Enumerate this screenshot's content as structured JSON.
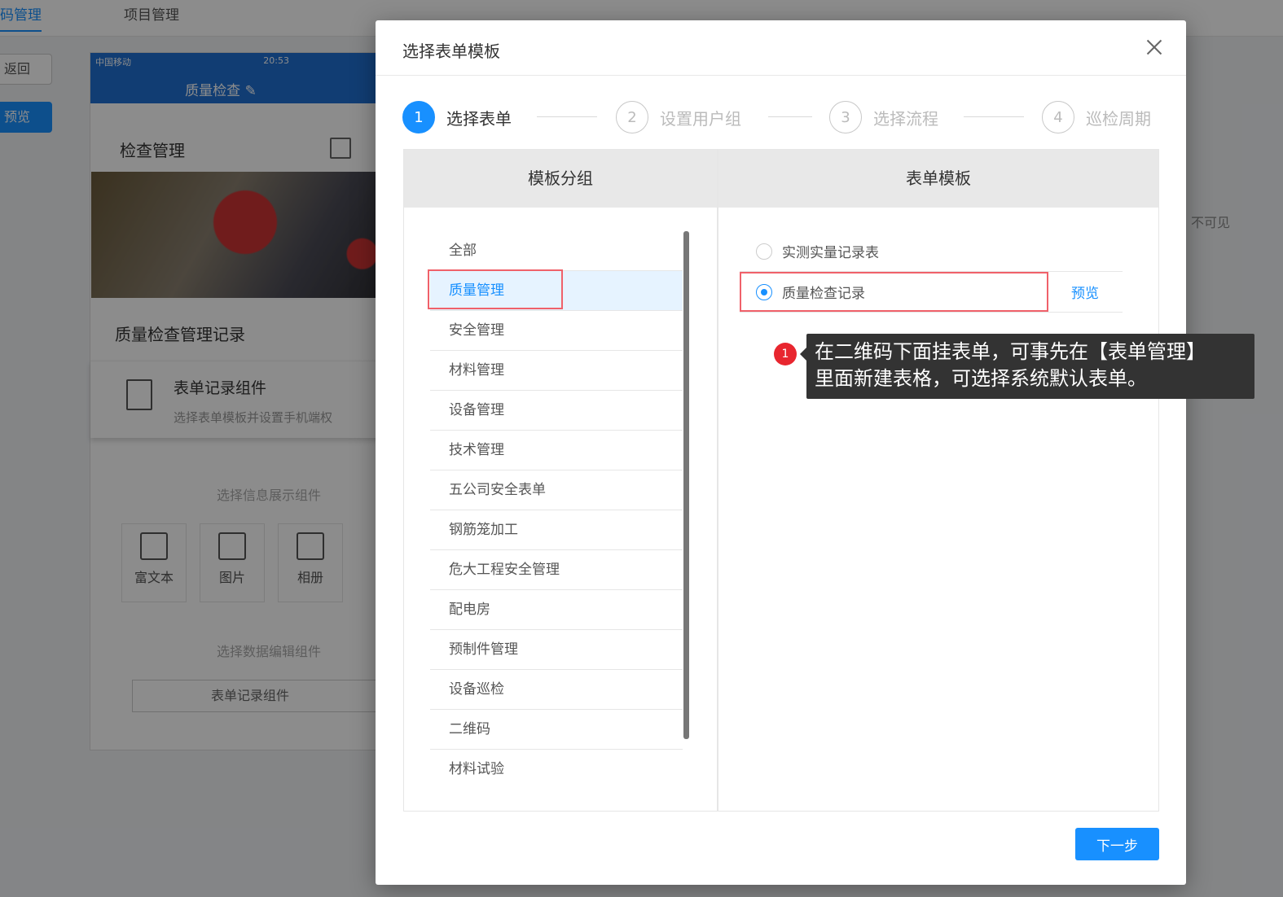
{
  "background": {
    "tabs": [
      "码管理",
      "项目管理"
    ],
    "back_label": "返回",
    "preview_label": "预览",
    "phone": {
      "carrier": "中国移动",
      "time": "20:53",
      "title": "质量检查",
      "card_title": "检查管理",
      "record_title": "质量检查管理记录",
      "component_name": "表单记录组件",
      "component_desc": "选择表单模板并设置手机端权"
    },
    "info_section_label": "选择信息展示组件",
    "tiles": [
      "富文本",
      "图片",
      "相册"
    ],
    "data_section_label": "选择数据编辑组件",
    "edit_component": "表单记录组件",
    "right_text": "不可见"
  },
  "modal": {
    "title": "选择表单模板",
    "steps": [
      {
        "num": "1",
        "label": "选择表单"
      },
      {
        "num": "2",
        "label": "设置用户组"
      },
      {
        "num": "3",
        "label": "选择流程"
      },
      {
        "num": "4",
        "label": "巡检周期"
      }
    ],
    "group_panel_title": "模板分组",
    "template_panel_title": "表单模板",
    "groups": [
      "全部",
      "质量管理",
      "安全管理",
      "材料管理",
      "设备管理",
      "技术管理",
      "五公司安全表单",
      "钢筋笼加工",
      "危大工程安全管理",
      "配电房",
      "预制件管理",
      "设备巡检",
      "二维码",
      "材料试验"
    ],
    "selected_group_index": 1,
    "templates": [
      {
        "name": "实测实量记录表",
        "selected": false
      },
      {
        "name": "质量检查记录",
        "selected": true,
        "action": "预览"
      }
    ],
    "next_label": "下一步"
  },
  "tooltip": {
    "badge": "1",
    "lines": [
      "在二维码下面挂表单，可事先在【表单管理】",
      "里面新建表格，可选择系统默认表单。"
    ]
  },
  "colors": {
    "primary": "#1890ff",
    "highlight_border": "#f0616a",
    "badge": "#e8262f",
    "tooltip_bg": "#333333"
  }
}
